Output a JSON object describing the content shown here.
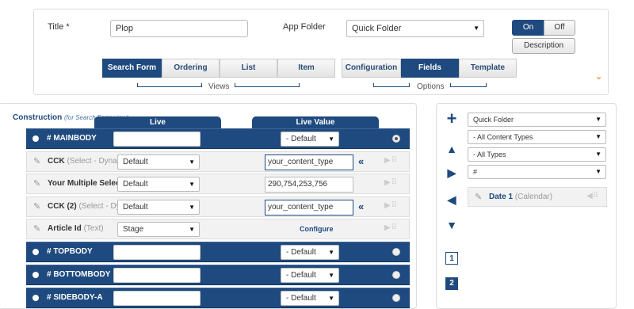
{
  "header": {
    "title_label": "Title *",
    "title_value": "Plop",
    "app_folder_label": "App Folder",
    "app_folder_value": "Quick Folder",
    "toggle": {
      "on": "On",
      "off": "Off",
      "active": "On"
    },
    "description_button": "Description"
  },
  "views_tabs": [
    "Search Form",
    "Ordering",
    "List",
    "Item"
  ],
  "options_tabs": [
    "Configuration",
    "Fields",
    "Template"
  ],
  "views_group_label": "Views",
  "options_group_label": "Options",
  "construction": {
    "title": "Construction",
    "subtitle": "(for Search Form view)",
    "live_header": "Live",
    "live_value_header": "Live Value"
  },
  "rows": [
    {
      "type": "position",
      "name": "# MAINBODY",
      "select": "- Default",
      "selected": true
    },
    {
      "type": "field",
      "name": "CCK",
      "sub": "(Select - Dynamic)",
      "live": "Default",
      "value": "your_content_type",
      "value_style": "input",
      "has_arrow": true
    },
    {
      "type": "field",
      "name": "Your Multiple Select",
      "sub": "",
      "live": "Default",
      "value": "290,754,253,756",
      "value_style": "input",
      "has_arrow": false
    },
    {
      "type": "field",
      "name": "CCK (2)",
      "sub": "(Select - Dynamic)",
      "live": "Default",
      "value": "your_content_type",
      "value_style": "input",
      "has_arrow": true
    },
    {
      "type": "field",
      "name": "Article Id",
      "sub": "(Text)",
      "live": "Stage",
      "value": "Configure",
      "value_style": "link",
      "has_arrow": false
    },
    {
      "type": "position",
      "name": "# TOPBODY",
      "select": "- Default",
      "selected": false
    },
    {
      "type": "position",
      "name": "# BOTTOMBODY",
      "select": "- Default",
      "selected": false
    },
    {
      "type": "position",
      "name": "# SIDEBODY-A",
      "select": "- Default",
      "selected": false
    }
  ],
  "filters": [
    "Quick Folder",
    "- All Content Types",
    "- All Types",
    "#"
  ],
  "available_fields": [
    {
      "name": "Date 1",
      "sub": "(Calendar)"
    }
  ],
  "nav_icons": [
    "plus-icon",
    "chevron-up-icon",
    "chevron-right-icon",
    "chevron-left-icon",
    "chevron-down-icon"
  ],
  "position_numbers": [
    "1",
    "2"
  ],
  "colors": {
    "primary": "#1f4a7f",
    "accent": "#e8a33d"
  }
}
